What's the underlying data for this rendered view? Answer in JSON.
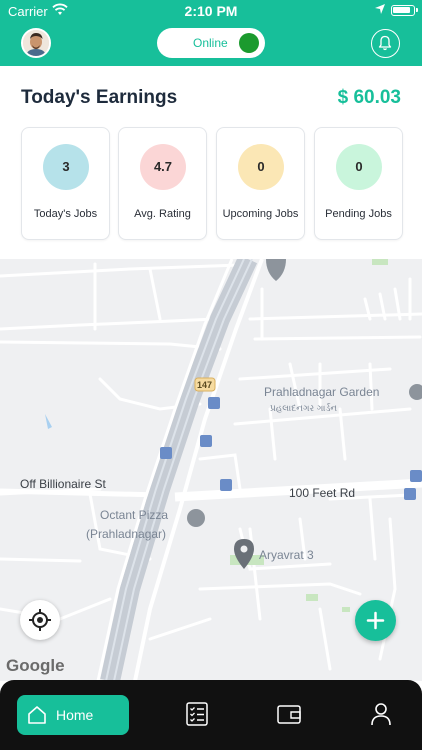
{
  "status_bar": {
    "carrier": "Carrier",
    "time": "2:10 PM"
  },
  "header": {
    "status_toggle_label": "Online"
  },
  "earnings": {
    "title": "Today's Earnings",
    "amount": "$ 60.03"
  },
  "stats": [
    {
      "value": "3",
      "label": "Today's Jobs",
      "color": "#b6e2ea"
    },
    {
      "value": "4.7",
      "label": "Avg. Rating",
      "color": "#fbd6d6"
    },
    {
      "value": "0",
      "label": "Upcoming Jobs",
      "color": "#fbe7b5"
    },
    {
      "value": "0",
      "label": "Pending Jobs",
      "color": "#c9f5dc"
    }
  ],
  "map": {
    "road_labels": [
      "147",
      "Off Billionaire St",
      "100 Feet Rd"
    ],
    "places": [
      "Prahladnagar Garden",
      "પ્રહલાદનગર ગાર્ડન",
      "Octant Pizza",
      "(Prahladnagar)",
      "Aryavrat 3"
    ],
    "attribution": "Google"
  },
  "bottom_nav": {
    "home_label": "Home"
  },
  "colors": {
    "accent": "#17bf9a",
    "online": "#1b9a2e",
    "nav_bg": "#111111"
  }
}
